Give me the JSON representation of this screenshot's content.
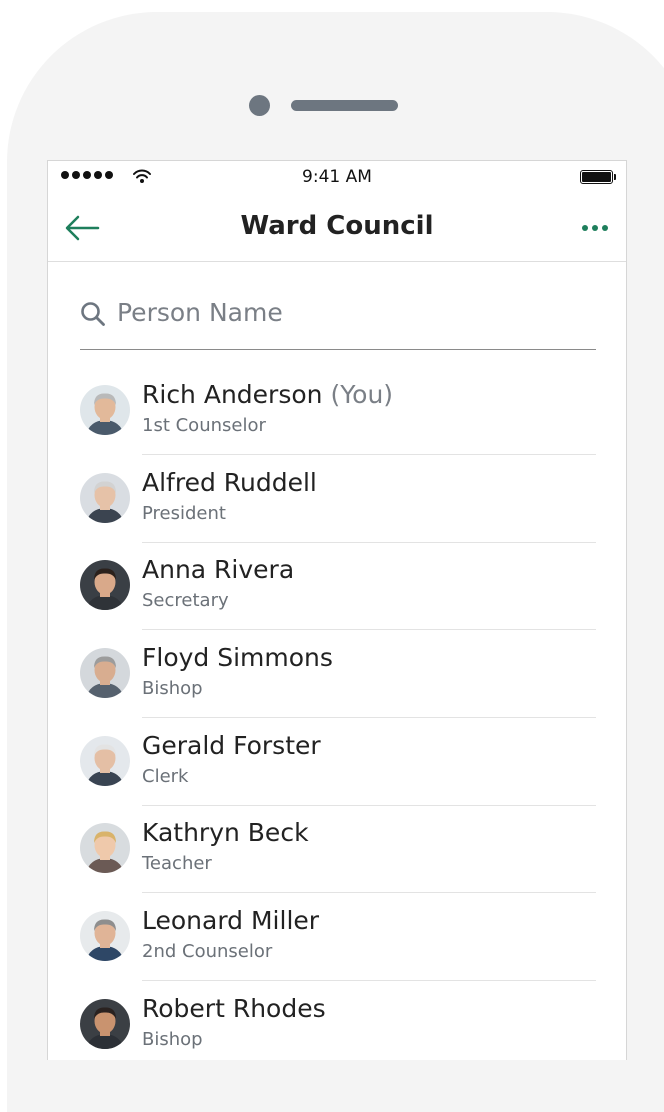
{
  "status_bar": {
    "time": "9:41 AM"
  },
  "nav": {
    "title": "Ward Council"
  },
  "search": {
    "placeholder": "Person Name"
  },
  "colors": {
    "accent": "#1e7f5c",
    "text": "#222222",
    "secondary": "#6b7178"
  },
  "people": [
    {
      "name": "Rich Anderson",
      "you": "(You)",
      "role": "1st Counselor",
      "skin": "#e2b99a",
      "hair": "#b9b9b9",
      "bg": "#dfe6ea",
      "shirt": "#4a5a6b"
    },
    {
      "name": "Alfred Ruddell",
      "you": "",
      "role": "President",
      "skin": "#e6c2a8",
      "hair": "#d2d2d2",
      "bg": "#d9dde2",
      "shirt": "#3b4450"
    },
    {
      "name": "Anna Rivera",
      "you": "",
      "role": "Secretary",
      "skin": "#d9a98a",
      "hair": "#2b211c",
      "bg": "#3a3f45",
      "shirt": "#2f3338"
    },
    {
      "name": "Floyd Simmons",
      "you": "",
      "role": "Bishop",
      "skin": "#d8ad90",
      "hair": "#9c9c9c",
      "bg": "#d4d8dc",
      "shirt": "#56616e"
    },
    {
      "name": "Gerald Forster",
      "you": "",
      "role": "Clerk",
      "skin": "#e4bfa5",
      "hair": "#e3e3e3",
      "bg": "#e4e8ec",
      "shirt": "#394452"
    },
    {
      "name": "Kathryn Beck",
      "you": "",
      "role": "Teacher",
      "skin": "#efc9ab",
      "hair": "#d9b36a",
      "bg": "#d8dcdf",
      "shirt": "#6b5a55"
    },
    {
      "name": "Leonard Miller",
      "you": "",
      "role": "2nd Counselor",
      "skin": "#e0b497",
      "hair": "#8e8e8e",
      "bg": "#e7eaec",
      "shirt": "#2e4766"
    },
    {
      "name": "Robert Rhodes",
      "you": "",
      "role": "Bishop",
      "skin": "#c9936f",
      "hair": "#2a2220",
      "bg": "#3b3f44",
      "shirt": "#2c3036"
    }
  ]
}
